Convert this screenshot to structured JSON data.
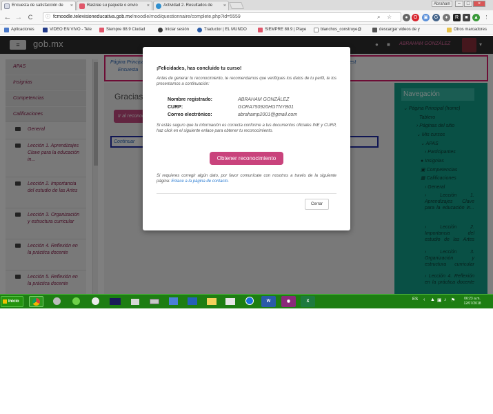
{
  "browser": {
    "tabs": [
      {
        "label": "Encuesta de satisfacción de",
        "active": true
      },
      {
        "label": "Rastree su paquete o envío",
        "active": false
      },
      {
        "label": "Actividad 2. Resultados de",
        "active": false
      }
    ],
    "tab_close_glyph": "×",
    "profile_name": "Abraham",
    "window_controls": {
      "minimize": "–",
      "maximize": "□",
      "close": "×"
    },
    "url_host": "fcmoodle.televisioneducativa.gob.mx",
    "url_path": "/moodle/mod/questionnaire/complete.php?id=5559",
    "nav_glyphs": {
      "back": "←",
      "forward": "→",
      "reload": "C"
    },
    "bookmarks": [
      "Aplicaciones",
      "VIDEO EN VIVO - Tele",
      "Siempre 88.9 Ciudad",
      "Iniciar sesión",
      "Traductor | EL MUNDO",
      "SIEMPRE 88.9 | Playe",
      "blanchos_construye@",
      "descargar videos de y",
      "Otros marcadores"
    ]
  },
  "site": {
    "menu_glyph": "≡",
    "brand": "gob.mx",
    "user_name": "ABRAHAM GONZÁLEZ",
    "user_menu_glyph": "▾"
  },
  "drawer": {
    "items": [
      "APAS",
      "Insignias",
      "Competencias",
      "Calificaciones"
    ],
    "sections": [
      "General",
      "Lección 1. Aprendizajes Clave para la educación in...",
      "Lección 2. Importancia del estudio de las Artes",
      "Lección 3. Organización y estructura curricular",
      "Lección 4. Reflexión en la práctica docente",
      "Lección 5. Reflexión en la práctica docente"
    ]
  },
  "page": {
    "breadcrumb_1": "Página Principal",
    "breadcrumb_1_tail": "est",
    "breadcrumb_2": "Encuesta",
    "heading": "Gracias",
    "button_partial": "Ir al reconocimiento",
    "continue_link": "Continuar"
  },
  "navigation": {
    "title": "Navegación",
    "home": "Página Principal (home)",
    "dashboard": "Tablero",
    "site_pages": "Páginas del sitio",
    "my_courses": "Mis cursos",
    "course": "APAS",
    "participants": "Participantes",
    "badges": "Insignias",
    "competencies": "Competencias",
    "grades": "Calificaciones",
    "general": "General",
    "lesson1": "Lección 1. Aprendizajes Clave para la educación in...",
    "lesson2": "Lección 2. Importancia del estudio de las Artes",
    "lesson3": "Lección 3. Organización y estructura curricular",
    "lesson4": "Lección 4. Reflexión en la práctica docente"
  },
  "modal": {
    "title": "¡Felicidades, has concluido tu curso!",
    "intro": "Antes de generar tu reconocimiento, te recomendamos que verifiques los datos de tu perfil, te los presentamos a continuación:",
    "fields": [
      {
        "label": "Nombre registrado:",
        "value": "ABRAHAM GONZÁLEZ"
      },
      {
        "label": "CURP:",
        "value": "GORA750920HGTNYB01"
      },
      {
        "label": "Correo electrónico:",
        "value": "abrahamp2001@gmail.com"
      }
    ],
    "confirm_text": "Si estás seguro que tu información es correcta conforme a tus documentos oficiales INE y CURP, haz click en el siguiente enlace para obtener tu reconocimiento.",
    "primary_button": "Obtener reconocimiento",
    "contact_text": "Si requieres corregir algún dato, por favor comunícate con nosotros a través de la siguiente página:",
    "contact_link": "Enlace a la página de contacto.",
    "close_button": "Cerrar"
  },
  "taskbar": {
    "start_label": "Inicio",
    "word_label": "W",
    "excel_label": "X",
    "language": "ES",
    "time": "06:23 a.m.",
    "date": "12/07/2018"
  },
  "colors": {
    "accent": "#c9437c",
    "nav_block": "#12a08a",
    "header": "#2f2f2f",
    "taskbar": "#1d7e12"
  }
}
